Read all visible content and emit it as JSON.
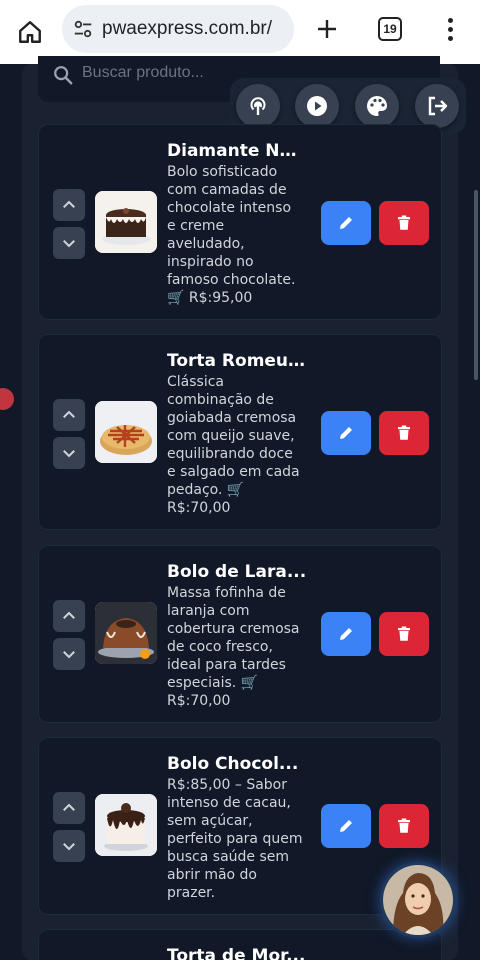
{
  "browser": {
    "url": "pwaexpress.com.br/",
    "tab_count": "19"
  },
  "search": {
    "placeholder": "Buscar produto..."
  },
  "toolbar": {
    "icons": [
      "podcast-icon",
      "play-icon",
      "palette-icon",
      "logout-icon"
    ]
  },
  "products": [
    {
      "title": "Diamante Ne...",
      "description": [
        "Bolo sofisticado",
        "com camadas de",
        "chocolate intenso",
        "e creme",
        "aveludado,",
        "inspirado no",
        "famoso chocolate."
      ],
      "price_line": "🛒 R$:95,00"
    },
    {
      "title": "Torta Romeu...",
      "description": [
        "Clássica",
        "combinação de",
        "goiabada cremosa",
        "com queijo suave,",
        "equilibrando doce",
        "e salgado em cada",
        "pedaço. 🛒"
      ],
      "price_line": "R$:70,00"
    },
    {
      "title": "Bolo de Lara...",
      "description": [
        "Massa fofinha de",
        "laranja com",
        "cobertura cremosa",
        "de coco fresco,",
        "ideal para tardes",
        "especiais. 🛒"
      ],
      "price_line": "R$:70,00"
    },
    {
      "title": "Bolo Chocol...",
      "description": [
        "R$:85,00 – Sabor",
        "intenso de cacau,",
        "sem açúcar,",
        "perfeito para quem",
        "busca saúde sem",
        "abrir mão do",
        "prazer."
      ],
      "price_line": ""
    },
    {
      "title": "Torta de Mor...",
      "description": [],
      "price_line": ""
    }
  ],
  "colors": {
    "edit": "#3b82f6",
    "delete": "#dc2636",
    "background": "#111827"
  }
}
